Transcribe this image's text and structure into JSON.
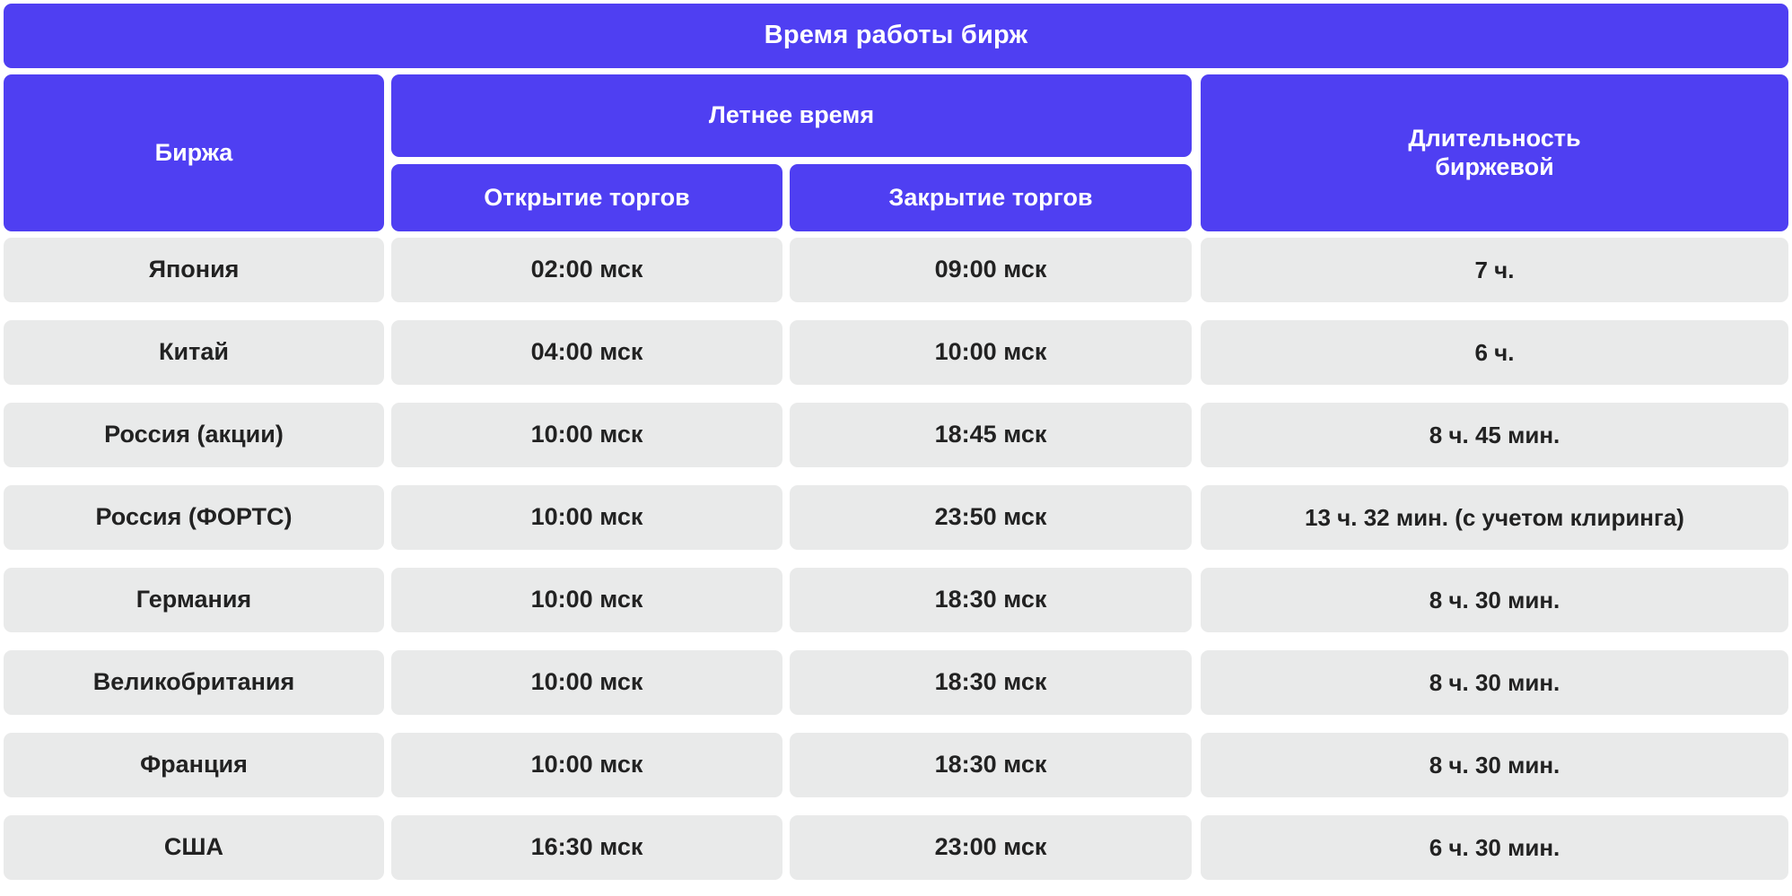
{
  "title": "Время работы бирж",
  "colors": {
    "header_blue": "#4F3FF2",
    "cell_gray": "#E9EAEA",
    "header_text": "#FFFFFF",
    "body_text": "#222222",
    "page_background": "#FFFFFF"
  },
  "header": {
    "exchange": "Биржа",
    "summer_time": "Летнее время",
    "open": "Открытие торгов",
    "close": "Закрытие торгов",
    "duration": "Длительность\nбиржевой"
  },
  "chart_data": {
    "type": "table",
    "title": "Время работы бирж",
    "columns": [
      "Биржа",
      "Открытие торгов",
      "Закрытие торгов",
      "Длительность биржевой"
    ],
    "column_groups": [
      {
        "label": "",
        "span": 1
      },
      {
        "label": "Летнее время",
        "span": 2
      },
      {
        "label": "Длительность биржевой",
        "span": 1
      }
    ],
    "rows": [
      {
        "exchange": "Япония",
        "open": "02:00 мск",
        "close": "09:00 мск",
        "duration": "7 ч."
      },
      {
        "exchange": "Китай",
        "open": "04:00 мск",
        "close": "10:00 мск",
        "duration": "6 ч."
      },
      {
        "exchange": "Россия (акции)",
        "open": "10:00 мск",
        "close": "18:45 мск",
        "duration": "8 ч. 45 мин."
      },
      {
        "exchange": "Россия (ФОРТС)",
        "open": "10:00 мск",
        "close": "23:50 мск",
        "duration": "13 ч. 32 мин. (с учетом клиринга)"
      },
      {
        "exchange": "Германия",
        "open": "10:00 мск",
        "close": "18:30 мск",
        "duration": "8 ч. 30 мин."
      },
      {
        "exchange": "Великобритания",
        "open": "10:00 мск",
        "close": "18:30 мск",
        "duration": "8 ч. 30 мин."
      },
      {
        "exchange": "Франция",
        "open": "10:00 мск",
        "close": "18:30 мск",
        "duration": "8 ч. 30 мин."
      },
      {
        "exchange": "США",
        "open": "16:30 мск",
        "close": "23:00 мск",
        "duration": "6 ч. 30 мин."
      }
    ]
  }
}
